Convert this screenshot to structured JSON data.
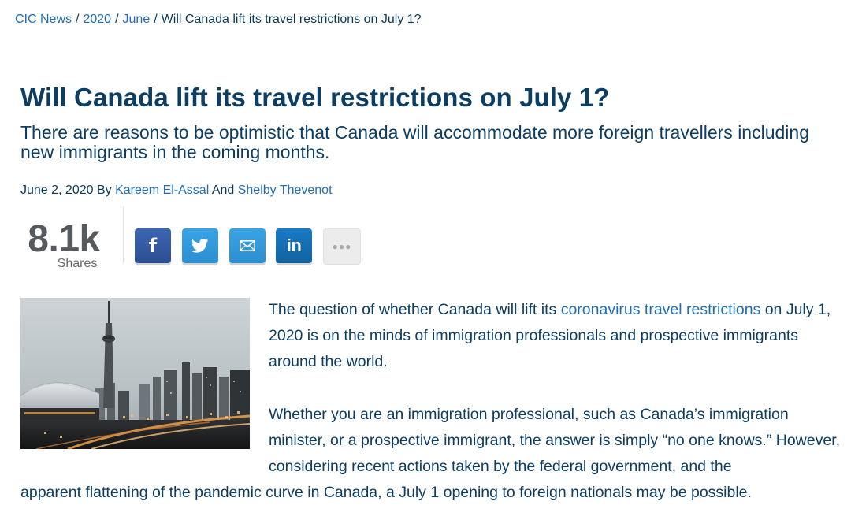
{
  "breadcrumb": {
    "items": [
      {
        "label": "CIC News"
      },
      {
        "label": "2020"
      },
      {
        "label": "June"
      }
    ],
    "current": "Will Canada lift its travel restrictions on July 1?",
    "separator": "/"
  },
  "article": {
    "title": "Will Canada lift its travel restrictions on July 1?",
    "subtitle": "There are reasons to be optimistic that Canada will accommodate more foreign travellers including new immigrants in the coming months.",
    "byline": {
      "date_prefix": "June 2, 2020 By",
      "author1": "Kareem El-Assal",
      "conjunction": "And",
      "author2": "Shelby Thevenot"
    }
  },
  "share": {
    "count": "8.1k",
    "label": "Shares",
    "buttons": [
      {
        "icon": "facebook-icon",
        "color": "#3b5998"
      },
      {
        "icon": "twitter-icon",
        "color": "#1da1f2"
      },
      {
        "icon": "email-icon",
        "color": "#2b8fd1"
      },
      {
        "icon": "linkedin-icon",
        "color": "#0e76a8"
      },
      {
        "icon": "more-icon",
        "color": "#ececec"
      }
    ]
  },
  "body": {
    "p1_before": "The question of whether Canada will lift its ",
    "p1_link": "coronavirus travel restrictions",
    "p1_after": " on July 1, 2020 is on the minds of immigration professionals and prospective immigrants around the world.",
    "p2_part1": "Whether you are an immigration professional, such as Canada’s immigration minister, or a prospective immigrant, the answer is simply “no one knows.” However, considering recent actions taken by the federal government, and the",
    "p2_part2": "apparent flattening of the pandemic curve in Canada, a July 1 opening to foreign nationals may be possible."
  },
  "colors": {
    "heading": "#0c3d63",
    "link": "#1f6fb2",
    "share_count": "#555a5f"
  }
}
